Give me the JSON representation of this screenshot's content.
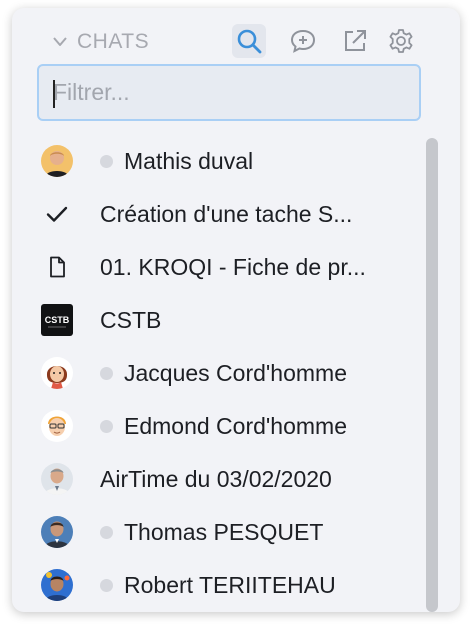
{
  "header": {
    "title": "CHATS",
    "icons": [
      "search-icon",
      "new-chat-icon",
      "external-open-icon",
      "settings-gear-icon"
    ]
  },
  "filter": {
    "placeholder": "Filtrer...",
    "value": ""
  },
  "colors": {
    "accent": "#3b8fd9",
    "panel_bg": "#f2f3f7",
    "status_dot": "#d6d8de"
  },
  "items": [
    {
      "label": "Mathis duval",
      "lead": "avatar",
      "status_dot": true
    },
    {
      "label": "Création d'une tache S...",
      "lead": "checkmark-icon",
      "status_dot": false
    },
    {
      "label": "01. KROQI - Fiche de pr...",
      "lead": "document-icon",
      "status_dot": false
    },
    {
      "label": "CSTB",
      "lead": "logo",
      "logo_text": "CSTB",
      "status_dot": false
    },
    {
      "label": "Jacques Cord'homme",
      "lead": "avatar",
      "status_dot": true
    },
    {
      "label": "Edmond Cord'homme",
      "lead": "avatar",
      "status_dot": true
    },
    {
      "label": "AirTime du 03/02/2020",
      "lead": "avatar",
      "status_dot": false
    },
    {
      "label": "Thomas PESQUET",
      "lead": "avatar",
      "status_dot": true
    },
    {
      "label": "Robert TERIITEHAU",
      "lead": "avatar",
      "status_dot": true
    }
  ]
}
